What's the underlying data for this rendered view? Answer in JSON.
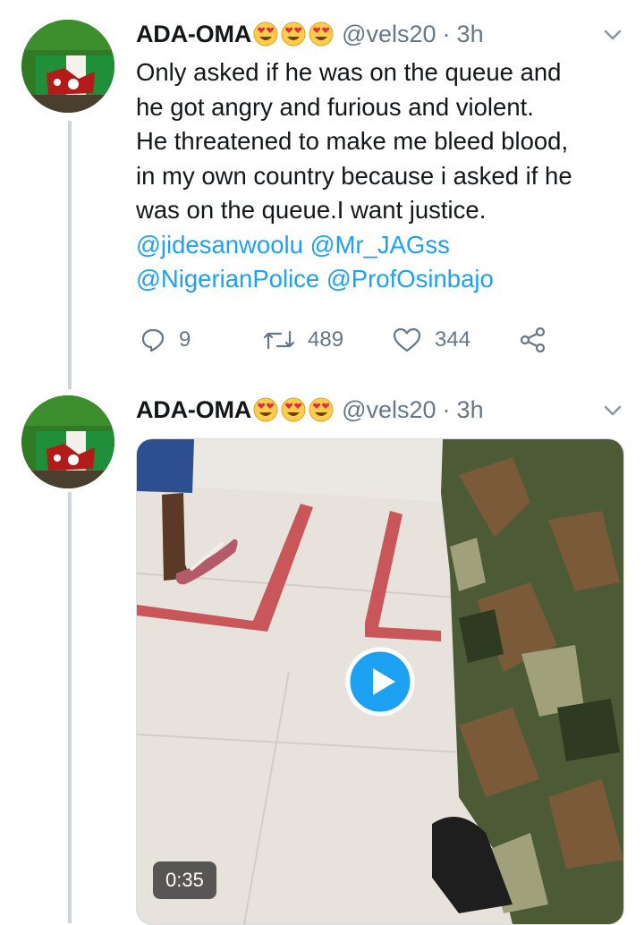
{
  "tweets": [
    {
      "display_name": "ADA-OMA",
      "emojis": [
        "heart-eyes-emoji",
        "heart-eyes-emoji",
        "heart-eyes-emoji"
      ],
      "handle": "@vels20",
      "separator": "·",
      "time": "3h",
      "text_lines": [
        "Only asked if he was on the queue and",
        "he got angry and furious and violent.",
        "He threatened to make me bleed blood,",
        "in my own country because i asked if he",
        "was on the queue.I want justice."
      ],
      "mentions": [
        [
          "@jidesanwoolu",
          "@Mr_JAGss"
        ],
        [
          "@NigerianPolice",
          "@ProfOsinbajo"
        ]
      ],
      "replies": "9",
      "retweets": "489",
      "likes": "344"
    },
    {
      "display_name": "ADA-OMA",
      "emojis": [
        "heart-eyes-emoji",
        "heart-eyes-emoji",
        "heart-eyes-emoji"
      ],
      "handle": "@vels20",
      "separator": "·",
      "time": "3h",
      "video_duration": "0:35"
    }
  ],
  "colors": {
    "link": "#1da1f2",
    "secondary_text": "#657786",
    "thread_line": "#ccd6dd",
    "play_button": "#1da1f2"
  }
}
